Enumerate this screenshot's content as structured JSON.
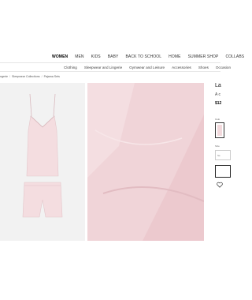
{
  "nav": {
    "main": [
      "WOMEN",
      "MEN",
      "KIDS",
      "BABY",
      "BACK TO SCHOOL",
      "HOME",
      "SUMMER SHOP",
      "COLLABS"
    ],
    "sub": [
      "Clothing",
      "Sleepwear and Lingerie",
      "Gymwear and Leisure",
      "Accessories",
      "Shoes",
      "Occasion"
    ]
  },
  "breadcrumb": [
    "ngerie",
    "Sleepwear Collections",
    "Pajama Sets"
  ],
  "product": {
    "title": "La",
    "subtitle": "A c",
    "price": "$12",
    "color_label": "Colo",
    "size_label": "Size",
    "size_placeholder": "Se",
    "swatch_color": "#f2d9dc",
    "fabric_color": "#f0d4d8",
    "garment_color": "#f4dde0"
  },
  "icons": {
    "wishlist": "heart-icon"
  }
}
